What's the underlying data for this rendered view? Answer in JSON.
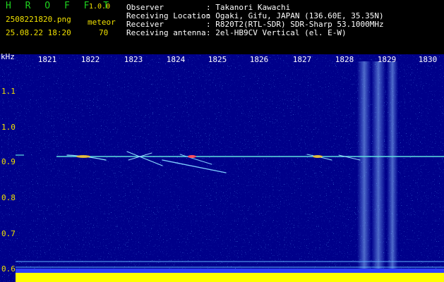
{
  "app": {
    "title": "H R O F F T",
    "version": "1.0.0"
  },
  "file": {
    "name": "2508221820.png",
    "datetime": "25.08.22 18:20"
  },
  "detection": {
    "label": "meteor",
    "count": "70"
  },
  "info": {
    "labels": [
      "Observer",
      "Receiving Location",
      "Receiver",
      "Receiving antenna"
    ],
    "values": [
      ": Takanori Kawachi",
      ": Ogaki, Gifu, JAPAN (136.60E, 35.35N)",
      ": R820T2(RTL-SDR) SDR-Sharp 53.1000MHz",
      ": 2el-HB9CV Vertical (el. E-W)"
    ]
  },
  "axes": {
    "unit": "kHz",
    "x_ticks": [
      "1821",
      "1822",
      "1823",
      "1824",
      "1825",
      "1826",
      "1827",
      "1828",
      "1829",
      "1830"
    ],
    "y_ticks": [
      "1.1",
      "1.0",
      "0.9",
      "0.8",
      "0.7",
      "0.6"
    ]
  },
  "colors": {
    "background": "#00008a",
    "carrier": "#5fe0e0",
    "accent": "#f0e000",
    "title": "#1fd21f"
  }
}
